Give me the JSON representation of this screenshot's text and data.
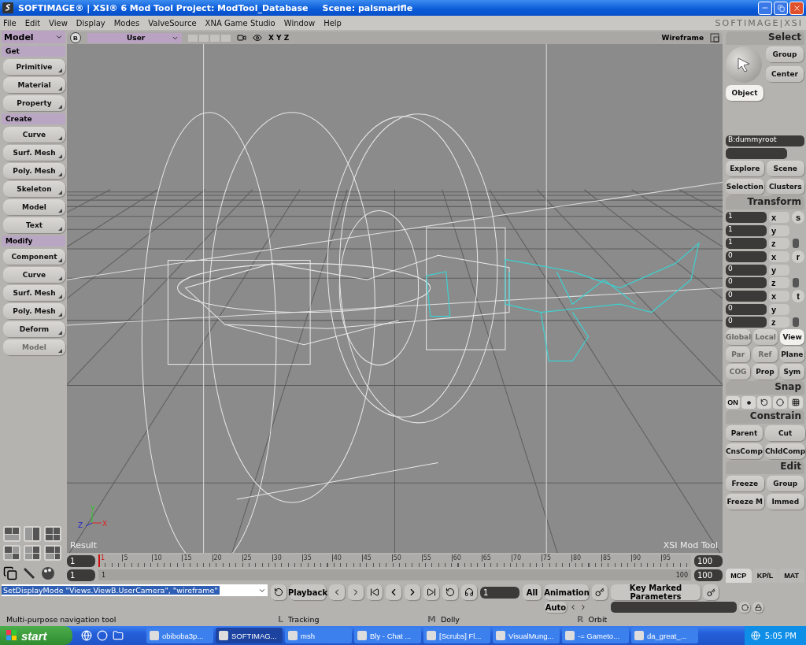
{
  "window": {
    "title": "SOFTIMAGE® | XSI® 6 Mod Tool Project: ModTool_Database",
    "scene": "Scene: palsmarifle"
  },
  "menu": [
    "File",
    "Edit",
    "View",
    "Display",
    "Modes",
    "ValveSource",
    "XNA Game Studio",
    "Window",
    "Help"
  ],
  "logo": "SOFTIMAGE|XSI",
  "left_panel": {
    "mode": "Model",
    "sections": [
      {
        "title": "Get",
        "buttons": [
          {
            "label": "Primitive",
            "disabled": false
          },
          {
            "label": "Material",
            "disabled": false
          },
          {
            "label": "Property",
            "disabled": false
          }
        ]
      },
      {
        "title": "Create",
        "buttons": [
          {
            "label": "Curve",
            "disabled": false
          },
          {
            "label": "Surf. Mesh",
            "disabled": false
          },
          {
            "label": "Poly. Mesh",
            "disabled": false
          },
          {
            "label": "Skeleton",
            "disabled": false
          },
          {
            "label": "Model",
            "disabled": false
          },
          {
            "label": "Text",
            "disabled": false
          }
        ]
      },
      {
        "title": "Modify",
        "buttons": [
          {
            "label": "Component",
            "disabled": false
          },
          {
            "label": "Curve",
            "disabled": false
          },
          {
            "label": "Surf. Mesh",
            "disabled": false
          },
          {
            "label": "Poly. Mesh",
            "disabled": false
          },
          {
            "label": "Deform",
            "disabled": false
          },
          {
            "label": "Model",
            "disabled": true
          }
        ]
      }
    ]
  },
  "viewport": {
    "view_button": "B",
    "camera": "User",
    "axes": "X Y Z",
    "display_mode": "Wireframe",
    "result_label": "Result",
    "product_label": "XSI Mod Tool",
    "gizmo": [
      "Y",
      "Z",
      "X"
    ]
  },
  "timeline": {
    "start": "1",
    "end": "100",
    "marker": "1",
    "ticks": [
      "5",
      "10",
      "15",
      "20",
      "25",
      "30",
      "35",
      "40",
      "45",
      "50",
      "55",
      "60",
      "65",
      "70",
      "75",
      "80",
      "85",
      "90",
      "95"
    ],
    "range_start": "1",
    "range": {
      "start_label": "1",
      "end_label": "100",
      "level": 1
    },
    "range_end": "100"
  },
  "right_panel": {
    "select": {
      "title": "Select",
      "buttons": [
        {
          "label": "Group",
          "selected": false
        },
        {
          "label": "Center",
          "selected": false
        },
        {
          "label": "Object",
          "selected": true
        }
      ],
      "name": "B:dummyroot",
      "links": [
        "Explore",
        "Scene",
        "Selection",
        "Clusters"
      ]
    },
    "transform": {
      "title": "Transform",
      "groups": [
        {
          "mode": "s",
          "values": [
            "1",
            "1",
            "1"
          ],
          "axes": [
            "x",
            "y",
            "z"
          ]
        },
        {
          "mode": "r",
          "values": [
            "0",
            "0",
            "0"
          ],
          "axes": [
            "x",
            "y",
            "z"
          ]
        },
        {
          "mode": "t",
          "values": [
            "0",
            "0",
            "0"
          ],
          "axes": [
            "x",
            "y",
            "z"
          ]
        }
      ],
      "option_rows": [
        [
          {
            "label": "Global",
            "selected": false,
            "disabled": true
          },
          {
            "label": "Local",
            "selected": false,
            "disabled": true
          },
          {
            "label": "View",
            "selected": true,
            "disabled": false
          }
        ],
        [
          {
            "label": "Par",
            "selected": false,
            "disabled": true
          },
          {
            "label": "Ref",
            "selected": false,
            "disabled": true
          },
          {
            "label": "Plane",
            "selected": false,
            "disabled": false
          }
        ],
        [
          {
            "label": "COG",
            "selected": false,
            "disabled": true
          },
          {
            "label": "Prop",
            "selected": false,
            "disabled": false
          },
          {
            "label": "Sym",
            "selected": false,
            "disabled": false
          }
        ]
      ]
    },
    "snap": {
      "title": "Snap",
      "on_label": "ON"
    },
    "constrain": {
      "title": "Constrain",
      "buttons": [
        "Parent",
        "Cut",
        "CnsComp",
        "ChldComp"
      ]
    },
    "edit": {
      "title": "Edit",
      "buttons": [
        "Freeze",
        "Group",
        "Freeze M",
        "Immed"
      ]
    },
    "tabs": [
      {
        "label": "MCP",
        "selected": true
      },
      {
        "label": "KP/L",
        "selected": false
      },
      {
        "label": "MAT",
        "selected": false
      }
    ]
  },
  "command": {
    "text": "SetDisplayMode \"Views.ViewB.UserCamera\", \"wireframe\"",
    "playback": "Playback",
    "frame": "1",
    "all": "All",
    "animation": "Animation",
    "auto": "Auto",
    "key_marked": "Key Marked Parameters"
  },
  "status": {
    "message": "Multi-purpose navigation tool",
    "mouse": [
      {
        "key": "L",
        "action": "Tracking"
      },
      {
        "key": "M",
        "action": "Dolly"
      },
      {
        "key": "R",
        "action": "Orbit"
      }
    ]
  },
  "taskbar": {
    "start": "start",
    "tasks": [
      {
        "label": "obiboba3p...",
        "selected": false
      },
      {
        "label": "SOFTIMAG...",
        "selected": true
      },
      {
        "label": "msh",
        "selected": false
      },
      {
        "label": "Bly - Chat ...",
        "selected": false
      },
      {
        "label": "[Scrubs] Fl...",
        "selected": false
      },
      {
        "label": "VisualMung...",
        "selected": false
      },
      {
        "label": "-= Gameto...",
        "selected": false
      },
      {
        "label": "da_great_...",
        "selected": false
      }
    ],
    "clock": "5:05 PM"
  }
}
